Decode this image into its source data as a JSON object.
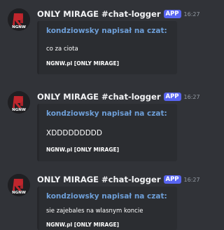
{
  "messages": [
    {
      "author": "ONLY MIRAGE #chat-logger",
      "badge": "APP",
      "time": "16:27",
      "avatar_text": "NGNW",
      "embed": {
        "title": "kondziowsky napisał na czat:",
        "description": "co za ciota",
        "footer": "NGNW.pl [ONLY MIRAGE]"
      }
    },
    {
      "author": "ONLY MIRAGE #chat-logger",
      "badge": "APP",
      "time": "16:27",
      "avatar_text": "NGNW",
      "embed": {
        "title": "kondziowsky napisał na czat:",
        "description": "XDDDDDDDDD",
        "footer": "NGNW.pl [ONLY MIRAGE]"
      }
    },
    {
      "author": "ONLY MIRAGE #chat-logger",
      "badge": "APP",
      "time": "16:27",
      "avatar_text": "NGNW",
      "embed": {
        "title": "kondziowsky napisał na czat:",
        "description": "sie zajebales na wlasnym koncie",
        "footer": "NGNW.pl [ONLY MIRAGE]"
      }
    }
  ],
  "colors": {
    "background": "#313338",
    "embed_background": "#2b2d31",
    "embed_title": "#6e9fd8",
    "app_badge": "#5865f2",
    "logo_red": "#c0262d"
  }
}
